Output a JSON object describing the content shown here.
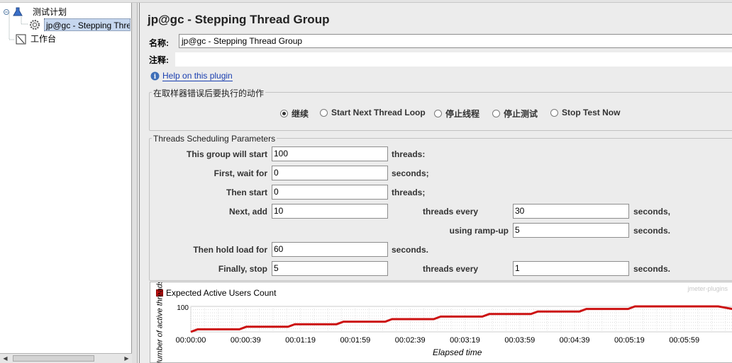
{
  "tree": {
    "test_plan": "测试计划",
    "thread_group": "jp@gc - Stepping Thre",
    "workbench": "工作台"
  },
  "panel": {
    "title": "jp@gc - Stepping Thread Group",
    "name_label": "名称:",
    "name_value": "jp@gc - Stepping Thread Group",
    "comment_label": "注释:",
    "comment_value": "",
    "help_link": "Help on this plugin"
  },
  "error_action": {
    "legend": "在取样器错误后要执行的动作",
    "options": [
      "继续",
      "Start Next Thread Loop",
      "停止线程",
      "停止测试",
      "Stop Test Now"
    ],
    "selected": "继续"
  },
  "scheduling": {
    "legend": "Threads Scheduling Parameters",
    "this_group_label": "This group will start",
    "this_group_value": "100",
    "threads_suffix": "threads:",
    "first_wait_label": "First, wait for",
    "first_wait_value": "0",
    "seconds_suffix": "seconds;",
    "then_start_label": "Then start",
    "then_start_value": "0",
    "then_start_suffix": "threads;",
    "next_add_label": "Next, add",
    "next_add_value": "10",
    "threads_every_label": "threads every",
    "every_value": "30",
    "seconds_comma": "seconds,",
    "ramp_label": "using ramp-up",
    "ramp_value": "5",
    "seconds_dot": "seconds.",
    "hold_label": "Then hold load for",
    "hold_value": "60",
    "hold_suffix": "seconds.",
    "finally_label": "Finally, stop",
    "finally_value": "5",
    "finally_every_label": "threads every",
    "finally_every_value": "1",
    "finally_suffix": "seconds."
  },
  "chart": {
    "watermark": "jmeter-plugins",
    "legend": "Expected Active Users Count",
    "ylabel": "Number of active threads",
    "xlabel": "Elapsed time",
    "series_color": "#cc1111"
  },
  "chart_data": {
    "type": "line",
    "x_ticks": [
      "00:00:00",
      "00:00:39",
      "00:01:19",
      "00:01:59",
      "00:02:39",
      "00:03:19",
      "00:03:59",
      "00:04:39",
      "00:05:19",
      "00:05:59",
      "00"
    ],
    "y_tick_label": "100",
    "series": [
      {
        "points": [
          [
            0,
            0
          ],
          [
            5,
            10
          ],
          [
            35,
            10
          ],
          [
            40,
            20
          ],
          [
            70,
            20
          ],
          [
            75,
            30
          ],
          [
            105,
            30
          ],
          [
            110,
            40
          ],
          [
            140,
            40
          ],
          [
            145,
            50
          ],
          [
            175,
            50
          ],
          [
            180,
            60
          ],
          [
            210,
            60
          ],
          [
            215,
            70
          ],
          [
            245,
            70
          ],
          [
            250,
            80
          ],
          [
            280,
            80
          ],
          [
            285,
            90
          ],
          [
            315,
            90
          ],
          [
            320,
            100
          ],
          [
            380,
            100
          ],
          [
            400,
            80
          ]
        ]
      }
    ],
    "x_range_seconds": [
      0,
      395
    ],
    "ylim": [
      0,
      100
    ]
  }
}
